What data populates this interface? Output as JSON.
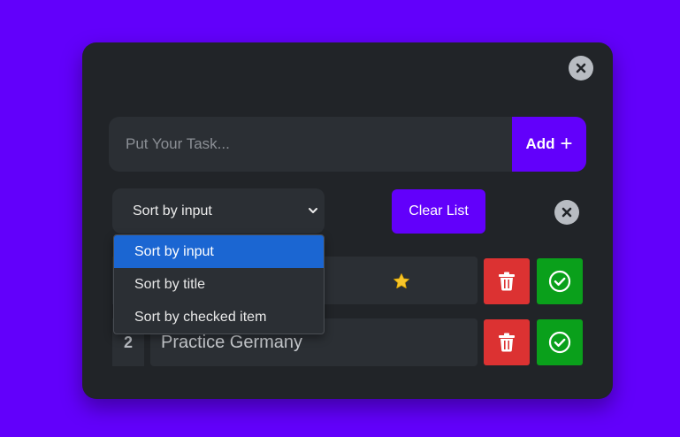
{
  "task_input": {
    "placeholder": "Put Your Task..."
  },
  "add_button": {
    "label": "Add",
    "icon": "+"
  },
  "sort": {
    "selected": "Sort by input",
    "options": [
      "Sort by input",
      "Sort by title",
      "Sort by checked item"
    ]
  },
  "clear_button": {
    "label": "Clear List"
  },
  "tasks": [
    {
      "number": "",
      "title": "",
      "starred": true
    },
    {
      "number": "2",
      "title": "Practice Germany",
      "starred": false
    }
  ],
  "colors": {
    "background": "#6200fb",
    "panel": "#212428",
    "accent": "#6200fb",
    "delete": "#dc3232",
    "check": "#0aa01b",
    "dropdown_selected": "#1b66d2"
  },
  "icons": [
    "close-icon",
    "plus-icon",
    "chevron-down-icon",
    "trash-icon",
    "check-circle-icon",
    "star-icon"
  ]
}
